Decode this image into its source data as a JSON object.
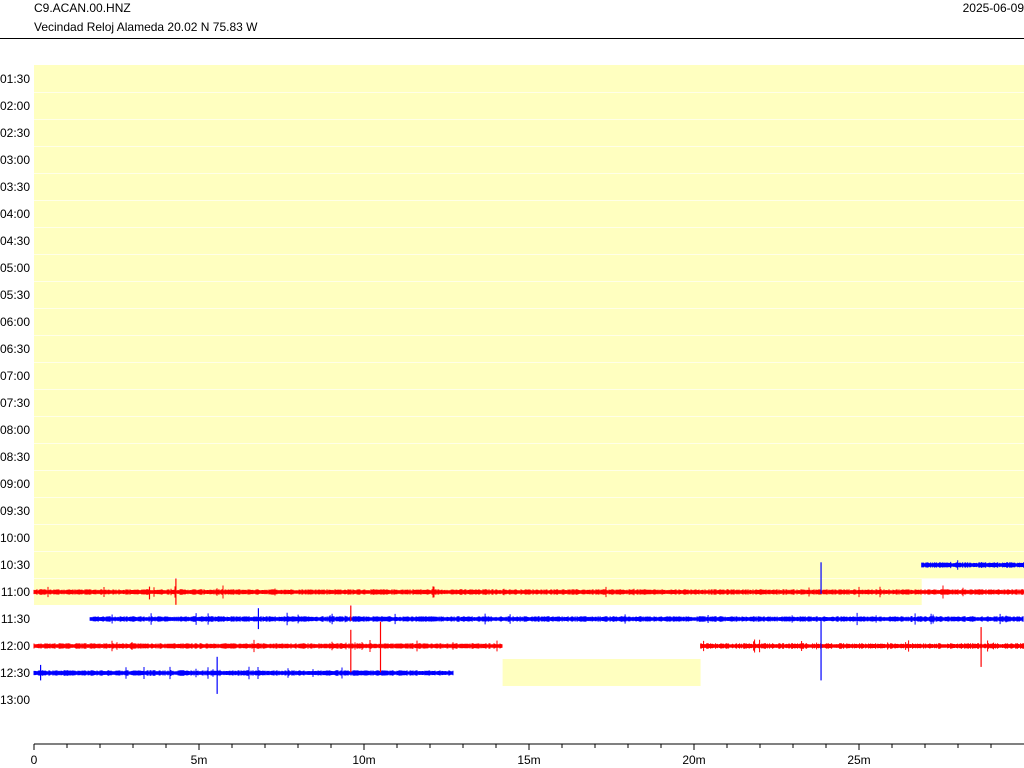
{
  "header": {
    "station": "C9.ACAN.00.HNZ",
    "location": "Vecindad Reloj Alameda  20.02 N 75.83 W",
    "date": "2025-06-09"
  },
  "chart_data": {
    "type": "helicorder",
    "row_labels": [
      "01:30",
      "02:00",
      "02:30",
      "03:00",
      "03:30",
      "04:00",
      "04:30",
      "05:00",
      "05:30",
      "06:00",
      "06:30",
      "07:00",
      "07:30",
      "08:00",
      "08:30",
      "09:00",
      "09:30",
      "10:00",
      "10:30",
      "11:00",
      "11:30",
      "12:00",
      "12:30",
      "13:00"
    ],
    "row_minutes": 30,
    "xlim": [
      0,
      30
    ],
    "x_ticks": [
      0,
      5,
      10,
      15,
      20,
      25
    ],
    "x_tick_labels": [
      "0",
      "5m",
      "10m",
      "15m",
      "20m",
      "25m"
    ],
    "trace_colors": [
      "#ff0000",
      "#0000ff"
    ],
    "gap_color": "#ffffc0",
    "gaps": [
      {
        "row_start": 0,
        "row_end": 18,
        "x_start": 0,
        "x_end": 30
      },
      {
        "row_start": 19,
        "row_end": 19,
        "x_start": 0,
        "x_end": 26.9
      },
      {
        "row_start": 22,
        "row_end": 22,
        "x_start": 14.2,
        "x_end": 20.2
      }
    ],
    "traces": [
      {
        "row": 18,
        "color": "#0000ff",
        "x_start": 26.9,
        "x_end": 30
      },
      {
        "row": 19,
        "color": "#ff0000",
        "x_start": 0,
        "x_end": 30
      },
      {
        "row": 20,
        "color": "#0000ff",
        "x_start": 1.7,
        "x_end": 30
      },
      {
        "row": 21,
        "color": "#ff0000",
        "x_start": 0,
        "x_end": 14.2
      },
      {
        "row": 21,
        "color": "#ff0000",
        "x_start": 20.2,
        "x_end": 30
      },
      {
        "row": 22,
        "color": "#0000ff",
        "x_start": 0,
        "x_end": 12.7
      }
    ],
    "spikes": [
      {
        "row": 19,
        "x": 4.3,
        "up": 0.5,
        "down": 0.4,
        "color": "#ff0000"
      },
      {
        "row": 19,
        "x": 3.5,
        "up": 0.2,
        "down": 0.2,
        "color": "#ff0000"
      },
      {
        "row": 19,
        "x": 23.85,
        "up": 1.1,
        "down": 0.0,
        "color": "#0000ff"
      },
      {
        "row": 20,
        "x": 23.85,
        "up": 0.0,
        "down": 2.2,
        "color": "#0000ff"
      },
      {
        "row": 20,
        "x": 6.8,
        "up": 0.4,
        "down": 0.3,
        "color": "#0000ff"
      },
      {
        "row": 20,
        "x": 9.6,
        "up": 0.5,
        "down": 0.0,
        "color": "#ff0000"
      },
      {
        "row": 21,
        "x": 9.6,
        "up": 0.6,
        "down": 0.9,
        "color": "#ff0000"
      },
      {
        "row": 21,
        "x": 10.5,
        "up": 0.9,
        "down": 0.9,
        "color": "#ff0000"
      },
      {
        "row": 21,
        "x": 28.7,
        "up": 0.7,
        "down": 0.7,
        "color": "#ff0000"
      },
      {
        "row": 22,
        "x": 5.55,
        "up": 0.6,
        "down": 0.7,
        "color": "#0000ff"
      },
      {
        "row": 22,
        "x": 0.2,
        "up": 0.3,
        "down": 0.2,
        "color": "#0000ff"
      }
    ]
  }
}
